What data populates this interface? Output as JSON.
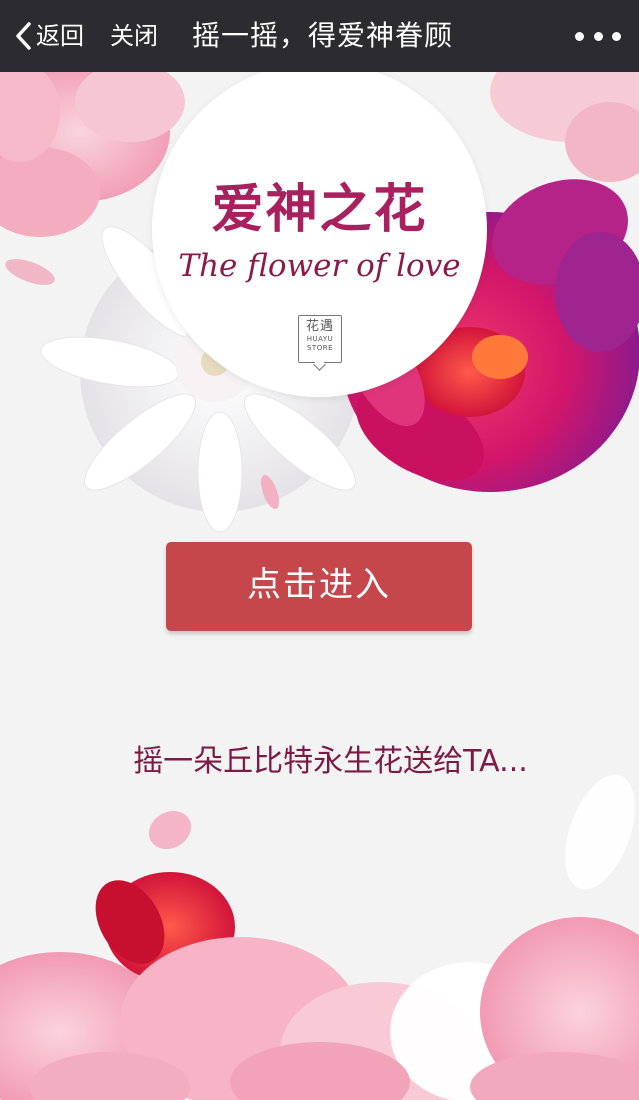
{
  "nav": {
    "back_label": "返回",
    "close_label": "关闭",
    "title": "摇一摇，得爱神眷顾",
    "more_icon": "more-dots-icon"
  },
  "hero": {
    "title": "爱神之花",
    "subtitle": "The flower of love",
    "store_badge": {
      "text_cn": "花遇",
      "text_en_1": "HUAYU",
      "text_en_2": "STORE"
    }
  },
  "enter_button": {
    "label": "点击进入"
  },
  "tagline": "摇一朵丘比特永生花送给TA...",
  "colors": {
    "nav_bg": "#2c2b2f",
    "button_bg": "#c5474b",
    "title_color": "#a8205e",
    "tagline_color": "#7b1a43",
    "background": "#f4f3f4"
  }
}
